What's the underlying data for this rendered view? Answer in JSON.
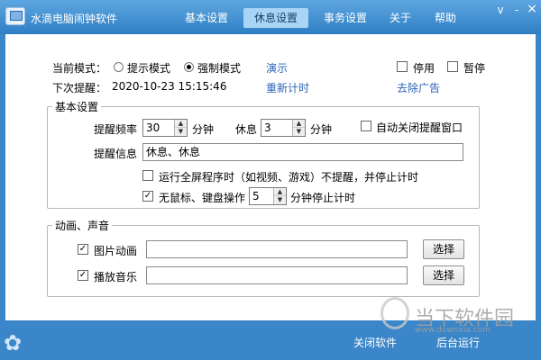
{
  "window": {
    "title": "水滴电脑闹钟软件",
    "minimize": "-",
    "close": "×",
    "menu": "v"
  },
  "nav": {
    "tabs": [
      {
        "label": "基本设置"
      },
      {
        "label": "休息设置",
        "active": true
      },
      {
        "label": "事务设置"
      },
      {
        "label": "关于"
      },
      {
        "label": "帮助"
      }
    ]
  },
  "mode": {
    "label": "当前模式：",
    "option_prompt": "提示模式",
    "option_force": "强制模式",
    "selected": "强制模式",
    "demo_link": "演示"
  },
  "next": {
    "label": "下次提醒：",
    "value": "2020-10-23 15:15:46",
    "reset_link": "重新计时"
  },
  "top_right": {
    "disable_label": "停用",
    "pause_label": "暂停",
    "remove_ads_link": "去除广告"
  },
  "basic": {
    "legend": "基本设置",
    "freq_label": "提醒频率",
    "freq_value": "30",
    "freq_unit": "分钟",
    "rest_label": "休息",
    "rest_value": "3",
    "rest_unit": "分钟",
    "auto_close_label": "自动关闭提醒窗口",
    "message_label": "提醒信息",
    "message_value": "休息、休息",
    "fullscreen_label": "运行全屏程序时（如视频、游戏）不提醒，并停止计时",
    "idle_label": "无鼠标、键盘操作",
    "idle_value": "5",
    "idle_unit": "分钟停止计时"
  },
  "media": {
    "legend": "动画、声音",
    "image_label": "图片动画",
    "image_path": "",
    "music_label": "播放音乐",
    "music_path": "",
    "select_label": "选择"
  },
  "footer": {
    "close_link": "关闭软件",
    "background_link": "后台运行"
  },
  "watermark": {
    "text": "当下软件园",
    "sub": "www.downxia.com"
  }
}
